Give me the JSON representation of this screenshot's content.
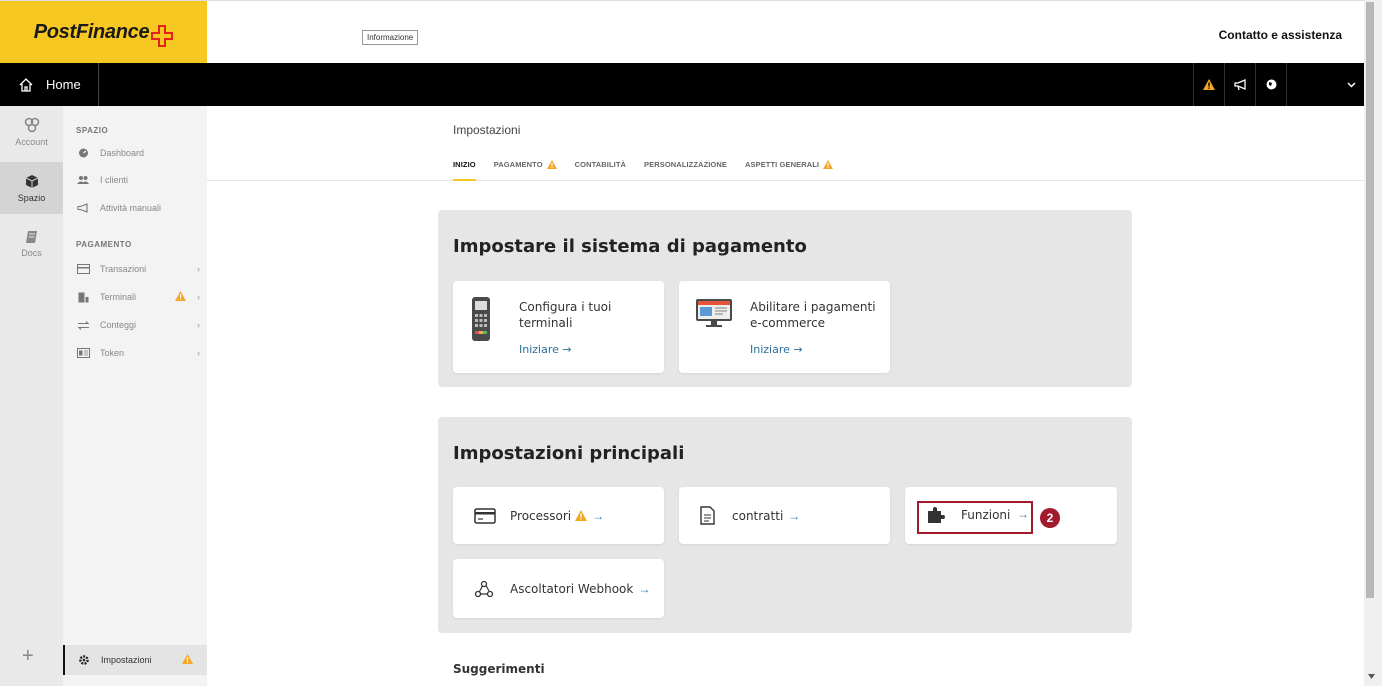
{
  "header": {
    "logo_text": "PostFinance",
    "info_button": "Informazione",
    "contact": "Contatto e assistenza"
  },
  "navbar": {
    "home_label": "Home",
    "icons": [
      "warning-icon",
      "megaphone-icon",
      "globe-icon",
      "chevron-down-icon"
    ]
  },
  "rail": {
    "items": [
      {
        "label": "Account",
        "icon": "account-icon"
      },
      {
        "label": "Spazio",
        "icon": "cube-icon"
      },
      {
        "label": "Docs",
        "icon": "book-icon"
      }
    ],
    "add": "+"
  },
  "sidebar": {
    "section1": "SPAZIO",
    "section1_items": [
      {
        "label": "Dashboard",
        "icon": "dashboard-icon"
      },
      {
        "label": "I clienti",
        "icon": "users-icon"
      },
      {
        "label": "Attività manuali",
        "icon": "megaphone-icon"
      }
    ],
    "section2": "PAGAMENTO",
    "section2_items": [
      {
        "label": "Transazioni",
        "icon": "card-icon"
      },
      {
        "label": "Terminali",
        "icon": "terminal-icon"
      },
      {
        "label": "Conteggi",
        "icon": "transfer-icon"
      },
      {
        "label": "Token",
        "icon": "token-icon"
      }
    ],
    "bottom_item": "Impostazioni",
    "chevron": "›"
  },
  "main": {
    "title": "Impostazioni",
    "tabs": [
      {
        "label": "INIZIO",
        "active": true,
        "warning": false
      },
      {
        "label": "PAGAMENTO",
        "active": false,
        "warning": true
      },
      {
        "label": "CONTABILITÀ",
        "active": false,
        "warning": false
      },
      {
        "label": "PERSONALIZZAZIONE",
        "active": false,
        "warning": false
      },
      {
        "label": "ASPETTI GENERALI",
        "active": false,
        "warning": true
      }
    ],
    "panel1": {
      "title": "Impostare il sistema di pagamento",
      "cards": [
        {
          "line1": "Configura i tuoi",
          "line2": "terminali",
          "link": "Iniziare →"
        },
        {
          "line1": "Abilitare i pagamenti",
          "line2": "e-commerce",
          "link": "Iniziare →"
        }
      ]
    },
    "panel2": {
      "title": "Impostazioni principali",
      "cards": [
        {
          "label": "Processori",
          "arrow": "→"
        },
        {
          "label": "contratti",
          "arrow": "→"
        },
        {
          "label": "Funzioni",
          "arrow": "→"
        },
        {
          "label": "Ascoltatori Webhook",
          "arrow": "→"
        }
      ],
      "step_badge": "2"
    },
    "suggestions": "Suggerimenti"
  },
  "colors": {
    "brand_yellow": "#f7c821",
    "warning": "#f5a623",
    "highlight": "#a11b2d",
    "link": "#2a6f9a"
  }
}
